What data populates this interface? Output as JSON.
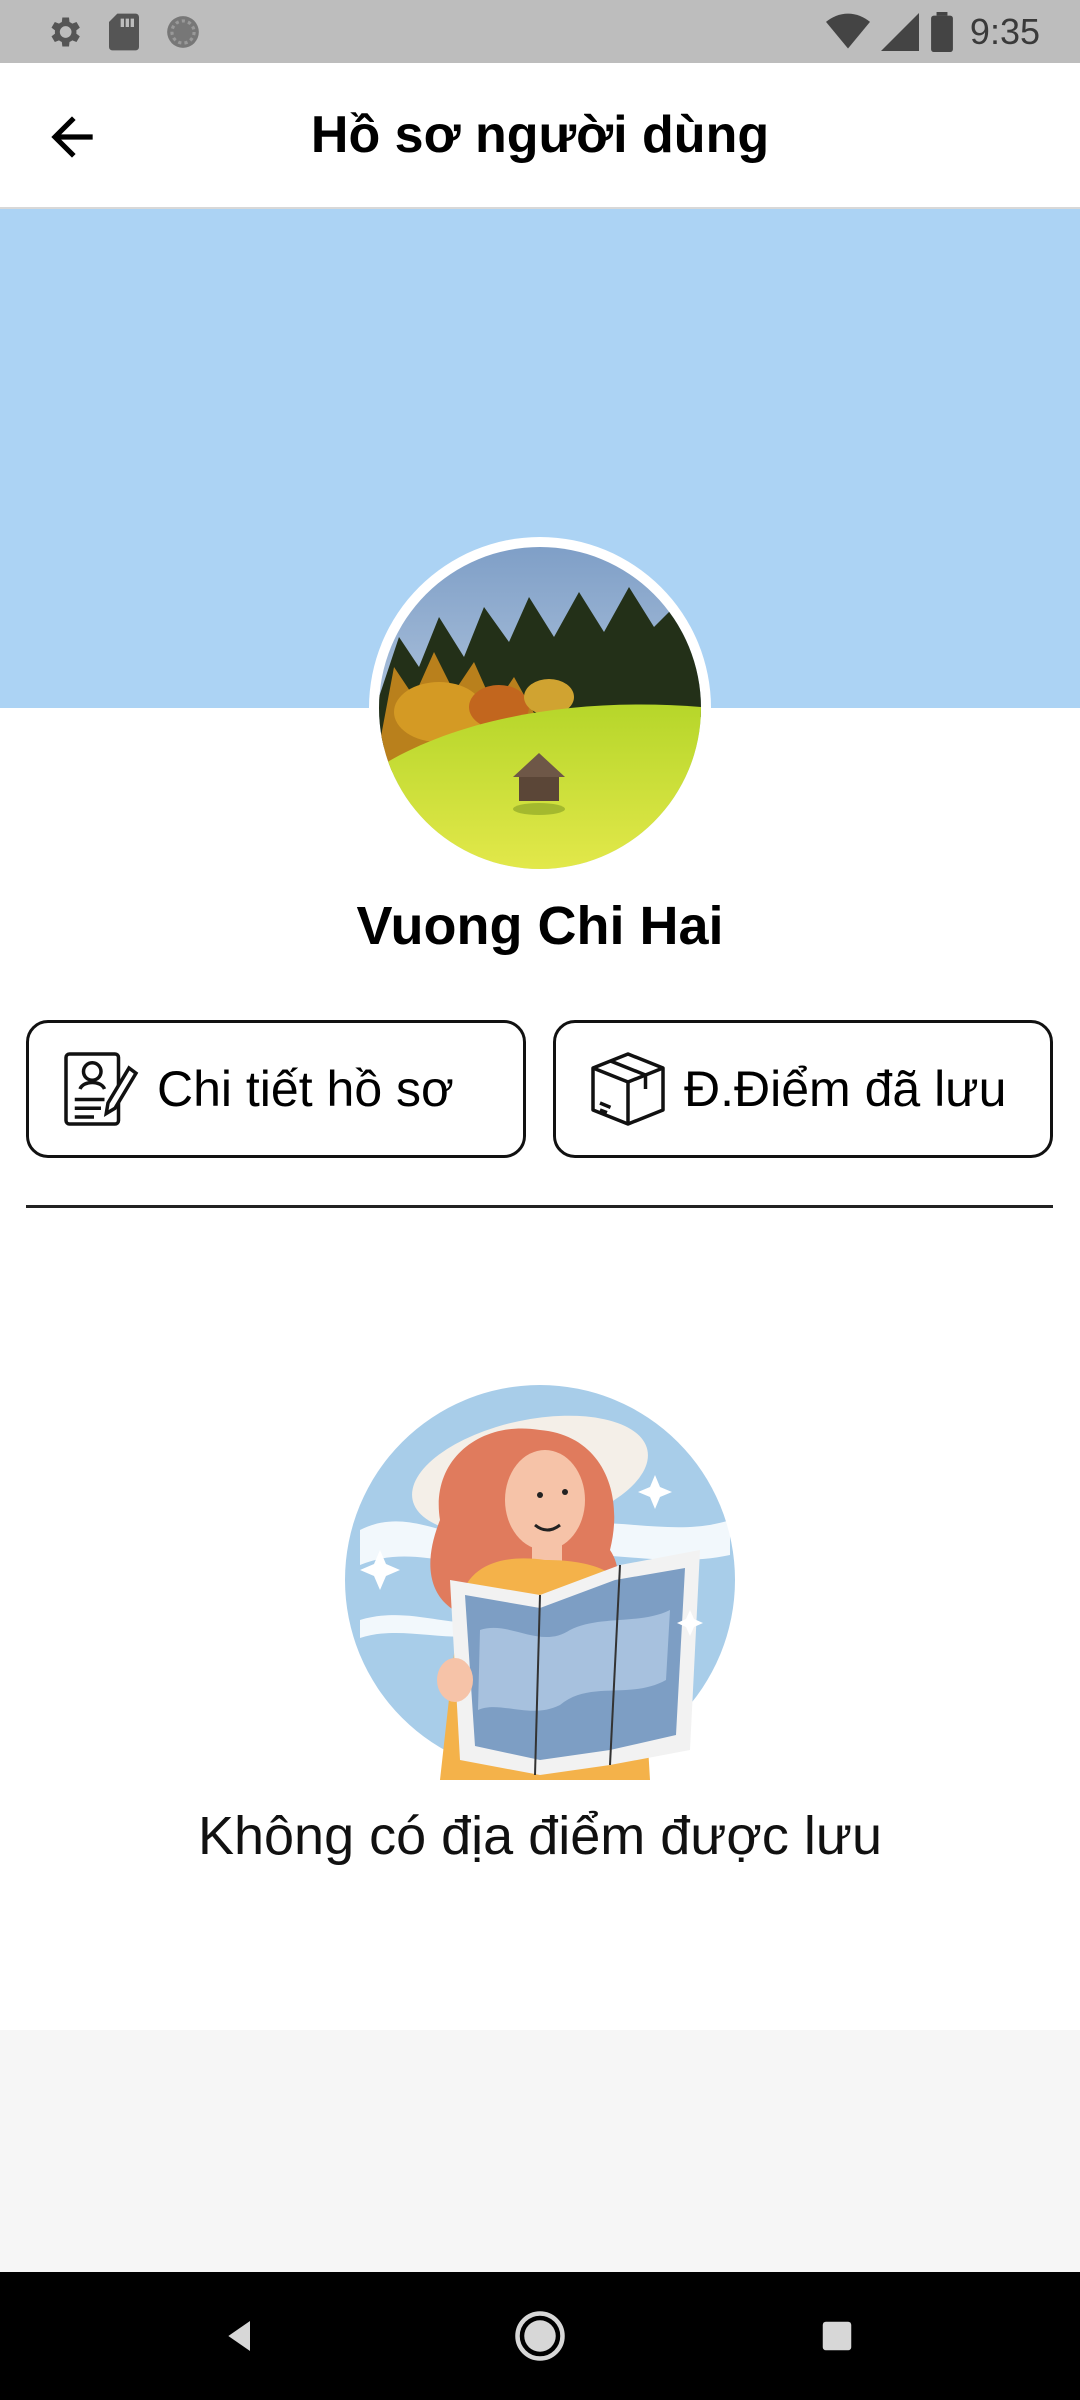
{
  "status_bar": {
    "time": "9:35",
    "left_icons": [
      "settings-icon",
      "sd-card-icon",
      "circle-status-icon"
    ],
    "right_icons": [
      "wifi-icon",
      "cellular-signal-icon",
      "battery-icon"
    ]
  },
  "header": {
    "title": "Hồ sơ người dùng",
    "back_icon": "arrow-left-icon"
  },
  "profile": {
    "name": "Vuong Chi Hai",
    "cover_color": "#acd3f4"
  },
  "buttons": {
    "profile_details": {
      "label": "Chi tiết hồ sơ",
      "icon": "profile-document-icon"
    },
    "saved_places": {
      "label": "Đ.Điểm đã lưu",
      "icon": "box-icon"
    }
  },
  "empty_state": {
    "message": "Không có địa điểm được lưu",
    "illustration": "woman-reading-map"
  },
  "nav_bar": {
    "icons": [
      "back-triangle-icon",
      "home-circle-icon",
      "recents-square-icon"
    ]
  }
}
